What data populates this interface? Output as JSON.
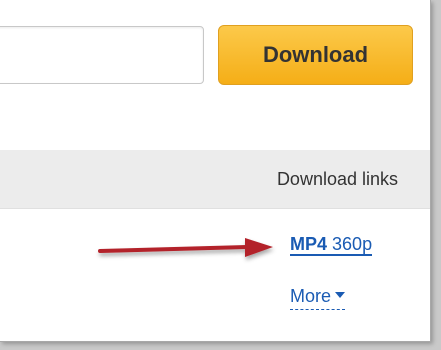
{
  "search": {
    "value": "",
    "placeholder": ""
  },
  "toolbar": {
    "download_label": "Download"
  },
  "links_section": {
    "header_label": "Download links",
    "formats": [
      {
        "type": "MP4",
        "quality": "360p"
      }
    ],
    "more_label": "More"
  },
  "colors": {
    "button_accent": "#f5ae17",
    "link": "#1a5bb3",
    "arrow": "#b3222a"
  },
  "icons": [
    "red-pointer-arrow-icon",
    "caret-down-icon"
  ]
}
